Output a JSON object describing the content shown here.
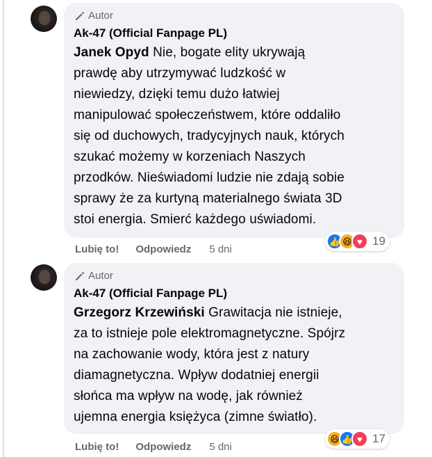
{
  "comments": [
    {
      "badge": "Autor",
      "author": "Ak-47 (Official Fanpage PL)",
      "mention": "Janek Opyd",
      "lines": [
        " Nie, bogate elity ukrywają",
        "prawdę aby utrzymywać ludzkość w",
        "niewiedzy, dzięki temu dużo łatwiej",
        "manipulować społeczeństwem, które oddaliło",
        "się od duchowych, tradycyjnych nauk, których",
        "szukać możemy w korzeniach Naszych",
        "przodków. Nieświadomi ludzie nie zdają sobie",
        "sprawy że za kurtyną materialnego świata 3D",
        "stoi energia. Smierć każdego uświadomi."
      ],
      "actions": {
        "like": "Lubię to!",
        "reply": "Odpowiedz",
        "time": "5 dni"
      },
      "reactions": {
        "icons": [
          "like-icon",
          "haha-icon",
          "love-icon"
        ],
        "count": "19"
      }
    },
    {
      "badge": "Autor",
      "author": "Ak-47 (Official Fanpage PL)",
      "mention": "Grzegorz Krzewiński",
      "lines": [
        " Grawitacja nie istnieje,",
        "za to istnieje pole elektromagnetyczne. Spójrz",
        "na zachowanie wody, która jest z natury",
        "diamagnetyczna. Wpływ dodatniej energii",
        "słońca ma wpływ na wodę, jak również",
        "ujemna energia księżyca (zimne światło)."
      ],
      "actions": {
        "like": "Lubię to!",
        "reply": "Odpowiedz",
        "time": "5 dni"
      },
      "reactions": {
        "icons": [
          "haha-icon",
          "like-icon",
          "love-icon"
        ],
        "count": "17"
      }
    }
  ],
  "colors": {
    "bubble": "#f0f2f5",
    "secondary_text": "#65676b",
    "like": "#1877f2",
    "haha": "#f7b125",
    "love": "#f33e58"
  }
}
